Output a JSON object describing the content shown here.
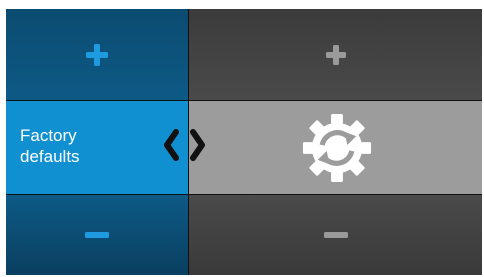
{
  "setting": {
    "label_line1": "Factory",
    "label_line2": "defaults"
  },
  "icons": {
    "increase": "plus-icon",
    "decrease": "minus-icon",
    "previous": "chevron-left-icon",
    "next": "chevron-right-icon",
    "setting": "gear-reset-icon"
  },
  "colors": {
    "active_blue": "#1090d0",
    "active_dark": "#0d5a86",
    "inactive_gray": "#9c9c9c",
    "icon_blue": "#1e9be0",
    "icon_gray": "#9a9a9a"
  }
}
